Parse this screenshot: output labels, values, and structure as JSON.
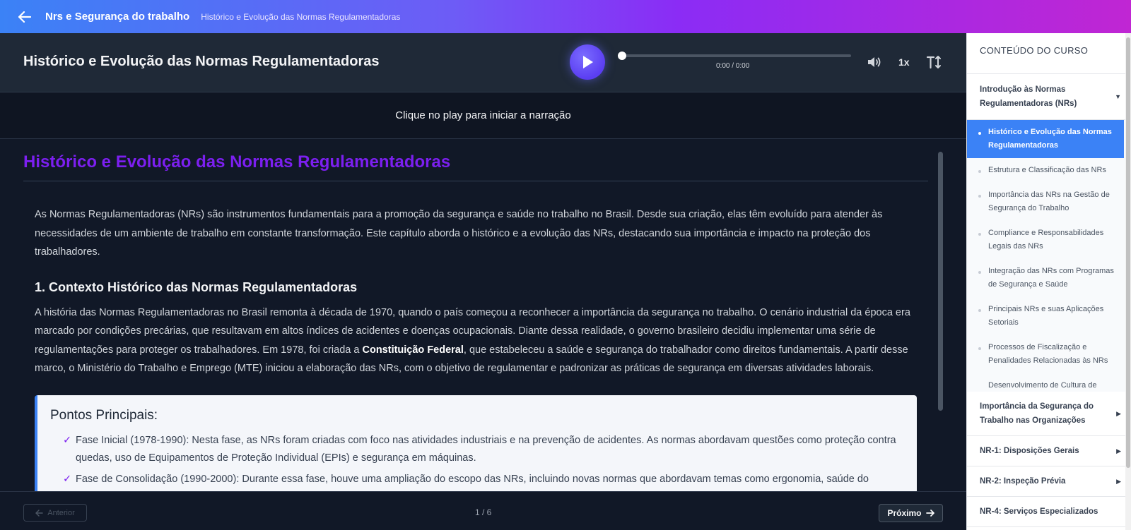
{
  "topbar": {
    "course_title": "Nrs e Segurança do trabalho",
    "breadcrumb": "Histórico e Evolução das Normas Regulamentadoras"
  },
  "player": {
    "title": "Histórico e Evolução das Normas Regulamentadoras",
    "time": "0:00 / 0:00",
    "progress": 0,
    "speed": "1x"
  },
  "narration": {
    "hint": "Clique no play para iniciar a narração"
  },
  "article": {
    "heading": "Histórico e Evolução das Normas Regulamentadoras",
    "intro": "As Normas Regulamentadoras (NRs) são instrumentos fundamentais para a promoção da segurança e saúde no trabalho no Brasil. Desde sua criação, elas têm evoluído para atender às necessidades de um ambiente de trabalho em constante transformação. Este capítulo aborda o histórico e a evolução das NRs, destacando sua importância e impacto na proteção dos trabalhadores.",
    "section1_title": "1. Contexto Histórico das Normas Regulamentadoras",
    "section1_text_a": "A história das Normas Regulamentadoras no Brasil remonta à década de 1970, quando o país começou a reconhecer a importância da segurança no trabalho. O cenário industrial da época era marcado por condições precárias, que resultavam em altos índices de acidentes e doenças ocupacionais. Diante dessa realidade, o governo brasileiro decidiu implementar uma série de regulamentações para proteger os trabalhadores. Em 1978, foi criada a ",
    "section1_bold": "Constituição Federal",
    "section1_text_b": ", que estabeleceu a saúde e segurança do trabalhador como direitos fundamentais. A partir desse marco, o Ministério do Trabalho e Emprego (MTE) iniciou a elaboração das NRs, com o objetivo de regulamentar e padronizar as práticas de segurança em diversas atividades laborais.",
    "points_title": "Pontos Principais:",
    "points": [
      "Fase Inicial (1978-1990): Nesta fase, as NRs foram criadas com foco nas atividades industriais e na prevenção de acidentes. As normas abordavam questões como proteção contra quedas, uso de Equipamentos de Proteção Individual (EPIs) e segurança em máquinas.",
      "Fase de Consolidação (1990-2000): Durante essa fase, houve uma ampliação do escopo das NRs, incluindo novas normas que abordavam temas como ergonomia, saúde do"
    ]
  },
  "footer": {
    "prev_label": "Anterior",
    "next_label": "Próximo",
    "page_indicator": "1 / 6"
  },
  "sidebar": {
    "header": "CONTEÚDO DO CURSO",
    "open_module": "Introdução às Normas Regulamentadoras (NRs)",
    "lessons": [
      "Histórico e Evolução das Normas Regulamentadoras",
      "Estrutura e Classificação das NRs",
      "Importância das NRs na Gestão de Segurança do Trabalho",
      "Compliance e Responsabilidades Legais das NRs",
      "Integração das NRs com Programas de Segurança e Saúde",
      "Principais NRs e suas Aplicações Setoriais",
      "Processos de Fiscalização e Penalidades Relacionadas às NRs",
      "Desenvolvimento de Cultura de"
    ],
    "modules": [
      "Importância da Segurança do Trabalho nas Organizações",
      "NR-1: Disposições Gerais",
      "NR-2: Inspeção Prévia",
      "NR-4: Serviços Especializados"
    ]
  },
  "colors": {
    "accent": "#7c1ff0",
    "active_lesson": "#3b82f6",
    "topbar_start": "#3b82f6",
    "topbar_end": "#c026d3"
  },
  "icons": [
    "arrow-left-icon",
    "play-icon",
    "volume-icon",
    "font-size-icon",
    "arrow-right-icon",
    "chevron-down-icon",
    "chevron-right-icon"
  ]
}
